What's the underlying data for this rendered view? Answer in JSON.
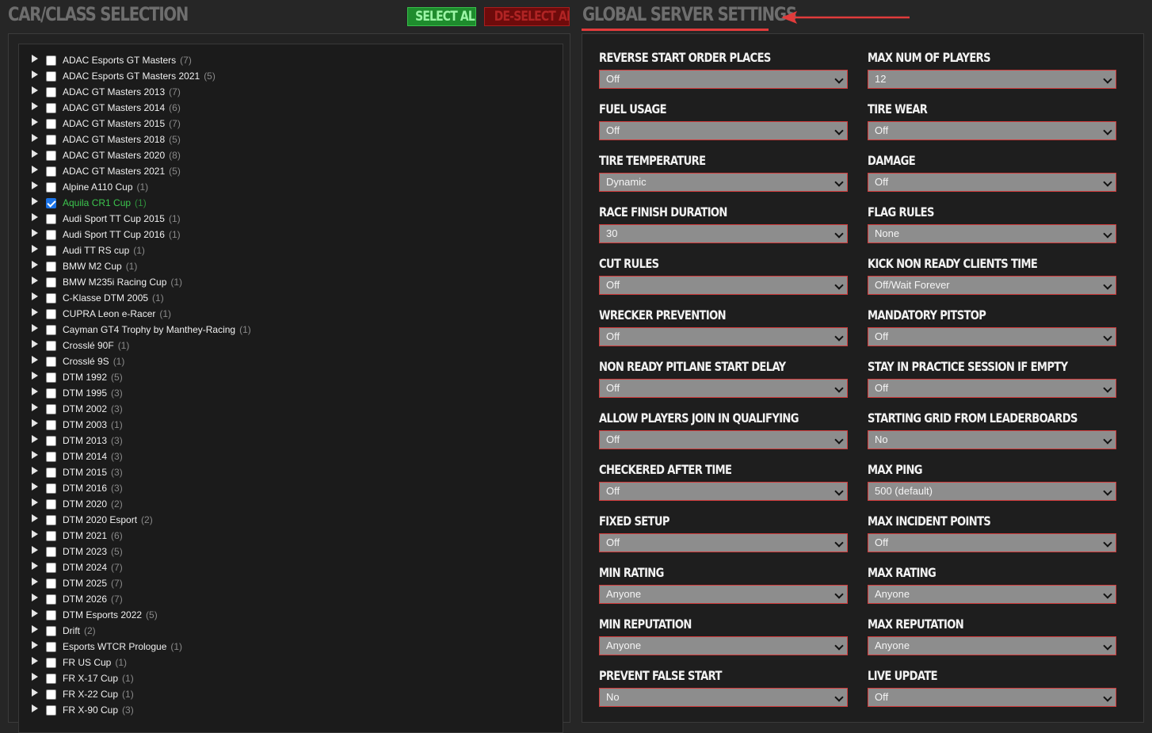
{
  "header": {
    "car_class_title": "CAR/CLASS SELECTION",
    "select_all_label": "SELECT ALL",
    "deselect_all_label": "DE-SELECT ALL",
    "global_settings_title": "GLOBAL SERVER SETTINGS"
  },
  "colors": {
    "select_all_bg": "#1e8c2d",
    "deselect_all_bg": "#6e0b0b",
    "accent_red": "#e13b3b",
    "selected_green": "#3cc64e"
  },
  "cars": [
    {
      "name": "ADAC Esports GT Masters",
      "count": "(7)",
      "checked": false
    },
    {
      "name": "ADAC Esports GT Masters 2021",
      "count": "(5)",
      "checked": false
    },
    {
      "name": "ADAC GT Masters 2013",
      "count": "(7)",
      "checked": false
    },
    {
      "name": "ADAC GT Masters 2014",
      "count": "(6)",
      "checked": false
    },
    {
      "name": "ADAC GT Masters 2015",
      "count": "(7)",
      "checked": false
    },
    {
      "name": "ADAC GT Masters 2018",
      "count": "(5)",
      "checked": false
    },
    {
      "name": "ADAC GT Masters 2020",
      "count": "(8)",
      "checked": false
    },
    {
      "name": "ADAC GT Masters 2021",
      "count": "(5)",
      "checked": false
    },
    {
      "name": "Alpine A110 Cup",
      "count": "(1)",
      "checked": false
    },
    {
      "name": "Aquila CR1 Cup",
      "count": "(1)",
      "checked": true
    },
    {
      "name": "Audi Sport TT Cup 2015",
      "count": "(1)",
      "checked": false
    },
    {
      "name": "Audi Sport TT Cup 2016",
      "count": "(1)",
      "checked": false
    },
    {
      "name": "Audi TT RS cup",
      "count": "(1)",
      "checked": false
    },
    {
      "name": "BMW M2 Cup",
      "count": "(1)",
      "checked": false
    },
    {
      "name": "BMW M235i Racing Cup",
      "count": "(1)",
      "checked": false
    },
    {
      "name": "C-Klasse DTM 2005",
      "count": "(1)",
      "checked": false
    },
    {
      "name": "CUPRA Leon e-Racer",
      "count": "(1)",
      "checked": false
    },
    {
      "name": "Cayman GT4 Trophy by Manthey-Racing",
      "count": "(1)",
      "checked": false
    },
    {
      "name": "Crosslé 90F",
      "count": "(1)",
      "checked": false
    },
    {
      "name": "Crosslé 9S",
      "count": "(1)",
      "checked": false
    },
    {
      "name": "DTM 1992",
      "count": "(5)",
      "checked": false
    },
    {
      "name": "DTM 1995",
      "count": "(3)",
      "checked": false
    },
    {
      "name": "DTM 2002",
      "count": "(3)",
      "checked": false
    },
    {
      "name": "DTM 2003",
      "count": "(1)",
      "checked": false
    },
    {
      "name": "DTM 2013",
      "count": "(3)",
      "checked": false
    },
    {
      "name": "DTM 2014",
      "count": "(3)",
      "checked": false
    },
    {
      "name": "DTM 2015",
      "count": "(3)",
      "checked": false
    },
    {
      "name": "DTM 2016",
      "count": "(3)",
      "checked": false
    },
    {
      "name": "DTM 2020",
      "count": "(2)",
      "checked": false
    },
    {
      "name": "DTM 2020 Esport",
      "count": "(2)",
      "checked": false
    },
    {
      "name": "DTM 2021",
      "count": "(6)",
      "checked": false
    },
    {
      "name": "DTM 2023",
      "count": "(5)",
      "checked": false
    },
    {
      "name": "DTM 2024",
      "count": "(7)",
      "checked": false
    },
    {
      "name": "DTM 2025",
      "count": "(7)",
      "checked": false
    },
    {
      "name": "DTM 2026",
      "count": "(7)",
      "checked": false
    },
    {
      "name": "DTM Esports 2022",
      "count": "(5)",
      "checked": false
    },
    {
      "name": "Drift",
      "count": "(2)",
      "checked": false
    },
    {
      "name": "Esports WTCR Prologue",
      "count": "(1)",
      "checked": false
    },
    {
      "name": "FR US Cup",
      "count": "(1)",
      "checked": false
    },
    {
      "name": "FR X-17 Cup",
      "count": "(1)",
      "checked": false
    },
    {
      "name": "FR X-22 Cup",
      "count": "(1)",
      "checked": false
    },
    {
      "name": "FR X-90 Cup",
      "count": "(3)",
      "checked": false
    }
  ],
  "settings": [
    {
      "label": "REVERSE START ORDER PLACES",
      "value": "Off"
    },
    {
      "label": "MAX NUM OF PLAYERS",
      "value": "12"
    },
    {
      "label": "FUEL USAGE",
      "value": "Off"
    },
    {
      "label": "TIRE WEAR",
      "value": "Off"
    },
    {
      "label": "TIRE TEMPERATURE",
      "value": "Dynamic"
    },
    {
      "label": "DAMAGE",
      "value": "Off"
    },
    {
      "label": "RACE FINISH DURATION",
      "value": "30"
    },
    {
      "label": "FLAG RULES",
      "value": "None"
    },
    {
      "label": "CUT RULES",
      "value": "Off"
    },
    {
      "label": "KICK NON READY CLIENTS TIME",
      "value": "Off/Wait Forever"
    },
    {
      "label": "WRECKER PREVENTION",
      "value": "Off"
    },
    {
      "label": "MANDATORY PITSTOP",
      "value": "Off"
    },
    {
      "label": "NON READY PITLANE START DELAY",
      "value": "Off"
    },
    {
      "label": "STAY IN PRACTICE SESSION IF EMPTY",
      "value": "Off"
    },
    {
      "label": "ALLOW PLAYERS JOIN IN QUALIFYING",
      "value": "Off"
    },
    {
      "label": "STARTING GRID FROM LEADERBOARDS",
      "value": "No"
    },
    {
      "label": "CHECKERED AFTER TIME",
      "value": "Off"
    },
    {
      "label": "MAX PING",
      "value": "500 (default)"
    },
    {
      "label": "FIXED SETUP",
      "value": "Off"
    },
    {
      "label": "MAX INCIDENT POINTS",
      "value": "Off"
    },
    {
      "label": "MIN RATING",
      "value": "Anyone"
    },
    {
      "label": "MAX RATING",
      "value": "Anyone"
    },
    {
      "label": "MIN REPUTATION",
      "value": "Anyone"
    },
    {
      "label": "MAX REPUTATION",
      "value": "Anyone"
    },
    {
      "label": "PREVENT FALSE START",
      "value": "No"
    },
    {
      "label": "LIVE UPDATE",
      "value": "Off"
    }
  ]
}
